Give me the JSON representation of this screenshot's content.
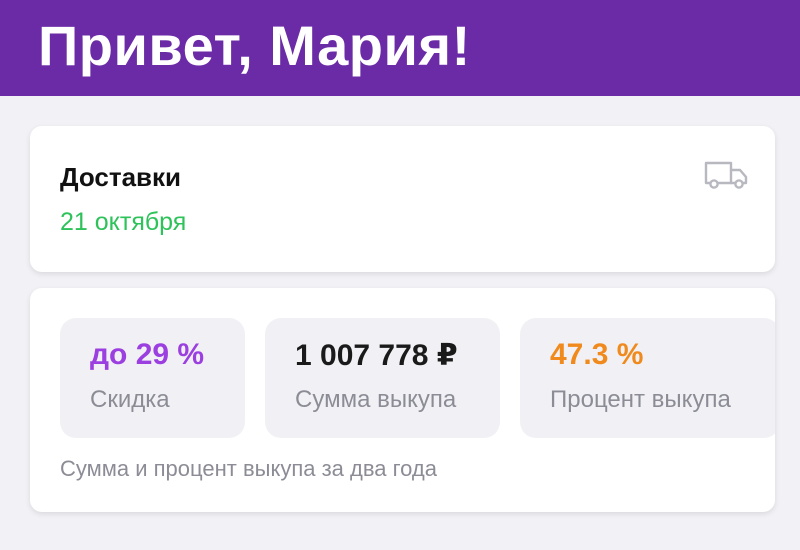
{
  "header": {
    "greeting": "Привет, Мария!",
    "background_color": "#6b2aa6"
  },
  "delivery": {
    "title": "Доставки",
    "date": "21 октября",
    "date_color": "#2ec25a",
    "icon": "truck-icon"
  },
  "stats": {
    "tiles": [
      {
        "value": "до 29 %",
        "label": "Скидка",
        "value_color": "#9b3fe0"
      },
      {
        "value": "1 007 778 ₽",
        "label": "Сумма выкупа",
        "value_color": "#1a1a1a"
      },
      {
        "value": "47.3 %",
        "label": "Процент выкупа",
        "value_color": "#f08a1c"
      }
    ],
    "footnote": "Сумма и процент выкупа за два года"
  }
}
